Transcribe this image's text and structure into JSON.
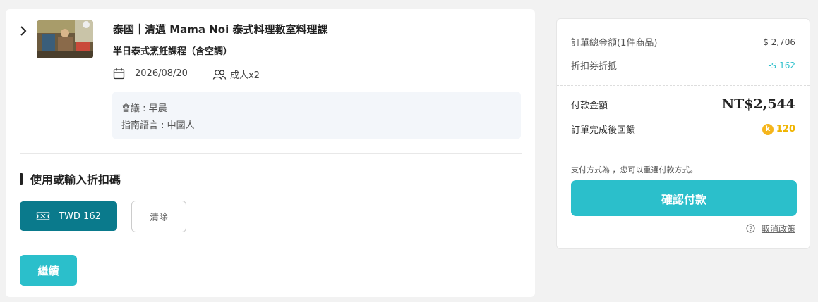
{
  "product": {
    "title": "泰國｜清邁 Mama Noi 泰式料理教室料理課",
    "subtitle": "半日泰式烹飪課程（含空調）",
    "date": "2026/08/20",
    "guests": "成人x2",
    "info": {
      "meeting": "會議 : 早晨",
      "language": "指南語言 : 中國人"
    },
    "icons": {
      "expand": "chevron-right-icon",
      "date": "calendar-icon",
      "guests": "people-icon"
    }
  },
  "coupon": {
    "section_title": "使用或輸入折扣碼",
    "applied_label": "TWD 162",
    "applied_icon": "ticket-icon",
    "clear_label": "清除"
  },
  "continue_label": "繼續",
  "summary": {
    "order_total_label": "訂單總金額(1件商品)",
    "order_total_value": "$ 2,706",
    "discount_label": "折扣券折抵",
    "discount_value": "-$ 162",
    "pay_label": "付款金額",
    "pay_value": "NT$2,544",
    "reward_label": "訂單完成後回饋",
    "reward_icon_char": "k",
    "reward_value": "120",
    "payment_note": "支付方式為 ，您可以重選付款方式。",
    "confirm_label": "確認付款",
    "policy_label": "取消政策",
    "policy_icon": "help-circle-icon"
  },
  "colors": {
    "accent": "#2bbfcb",
    "accent_dark": "#0a7a8c",
    "reward": "#f5b51c",
    "background": "#f2f2f2"
  }
}
